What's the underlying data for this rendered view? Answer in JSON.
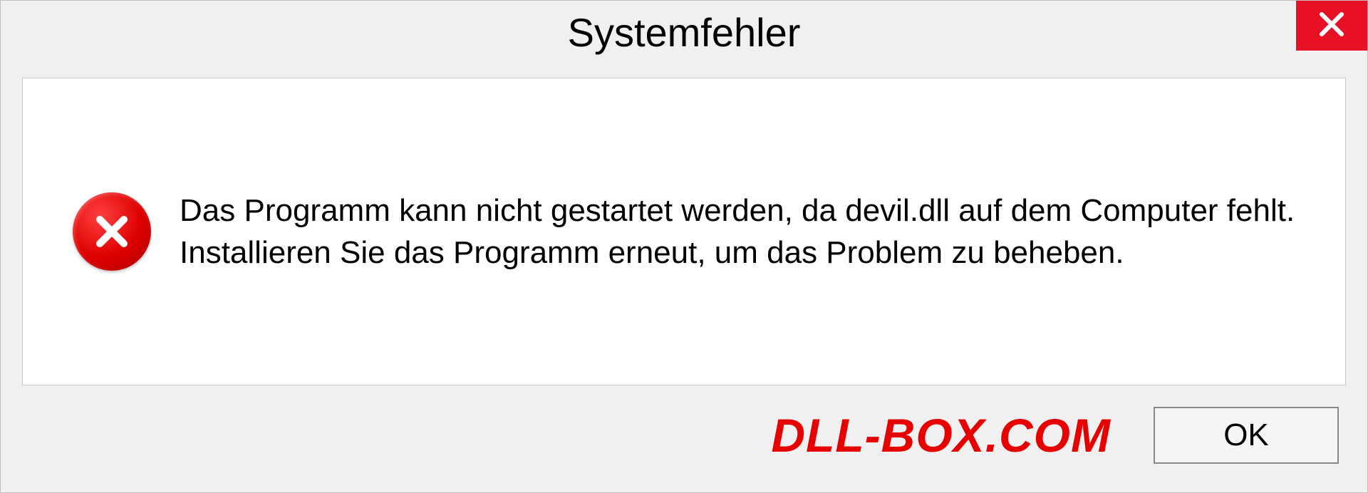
{
  "dialog": {
    "title": "Systemfehler",
    "message": "Das Programm kann nicht gestartet werden, da devil.dll auf dem Computer fehlt. Installieren Sie das Programm erneut, um das Problem zu beheben.",
    "ok_label": "OK"
  },
  "watermark": "DLL-BOX.COM"
}
